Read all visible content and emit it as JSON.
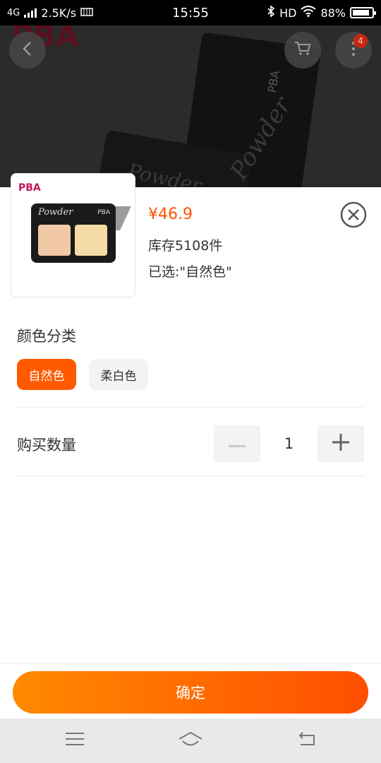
{
  "status_bar": {
    "network": "4G",
    "speed": "2.5K/s",
    "time": "15:55",
    "hd": "HD",
    "battery": "88%",
    "battery_level": 0.88
  },
  "header": {
    "icons": [
      "back-icon",
      "cart-icon",
      "more-icon"
    ],
    "badge_count": "4"
  },
  "product": {
    "brand": "PBA",
    "product_word": "Powder",
    "price": "¥46.9",
    "stock": "库存5108件",
    "selected": "已选:\"自然色\""
  },
  "color": {
    "title": "颜色分类",
    "options": [
      "自然色",
      "柔白色"
    ],
    "selected_index": 0
  },
  "quantity": {
    "label": "购买数量",
    "value": "1"
  },
  "confirm": {
    "label": "确定"
  },
  "colors": {
    "accent": "#ff5000",
    "button_gradient_start": "#ff8a00",
    "button_gradient_end": "#ff4e00"
  },
  "nav": {
    "icons": [
      "menu-icon",
      "home-icon",
      "return-icon"
    ]
  }
}
